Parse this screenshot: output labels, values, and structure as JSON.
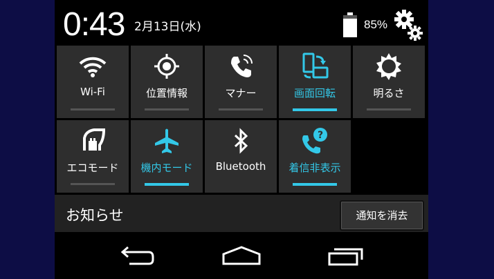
{
  "status": {
    "time": "0:43",
    "date": "2月13日(水)",
    "battery_percent": "85%",
    "battery_level": 0.85
  },
  "tiles": [
    {
      "label": "Wi-Fi",
      "icon": "wifi-icon",
      "active": false
    },
    {
      "label": "位置情報",
      "icon": "location-icon",
      "active": false
    },
    {
      "label": "マナー",
      "icon": "phone-vibrate-icon",
      "active": false
    },
    {
      "label": "画面回転",
      "icon": "screen-rotate-icon",
      "active": true
    },
    {
      "label": "明るさ",
      "icon": "brightness-icon",
      "active": false
    },
    {
      "label": "エコモード",
      "icon": "eco-mode-icon",
      "active": false
    },
    {
      "label": "機内モード",
      "icon": "airplane-icon",
      "active": true
    },
    {
      "label": "Bluetooth",
      "icon": "bluetooth-icon",
      "active": false
    },
    {
      "label": "着信非表示",
      "icon": "call-hide-icon",
      "active": true
    }
  ],
  "notifications": {
    "title": "お知らせ",
    "clear_label": "通知を消去"
  },
  "colors": {
    "accent": "#33c8e8",
    "tile_bg": "#2e2e2e",
    "backdrop": "#0d0d45"
  }
}
